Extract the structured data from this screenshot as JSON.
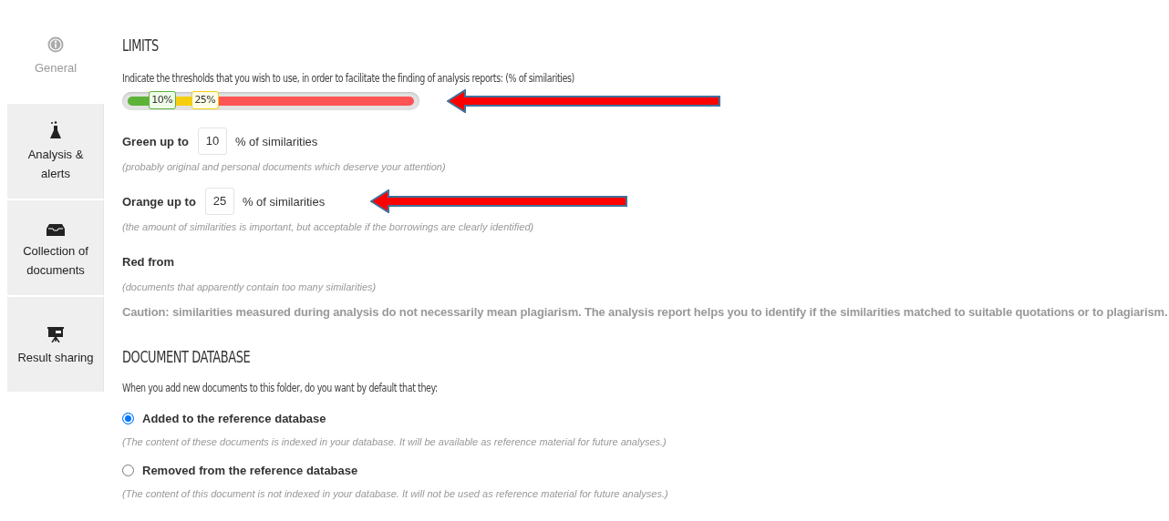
{
  "sidebar": {
    "items": [
      {
        "label": "General",
        "selected": true
      },
      {
        "label": "Analysis & alerts",
        "selected": false
      },
      {
        "label": "Collection of documents",
        "selected": false
      },
      {
        "label": "Result sharing",
        "selected": false
      }
    ]
  },
  "limits": {
    "title": "LIMITS",
    "description": "Indicate the thresholds that you wish to use, in order to facilitate the finding of analysis reports: (% of similarities)",
    "slider": {
      "thumbs": [
        {
          "label": "10%",
          "level": 0.12,
          "color": "#5cb338"
        },
        {
          "label": "25%",
          "level": 0.27,
          "color": "#f5cf0f"
        }
      ]
    },
    "thresholds": [
      {
        "label": "Green up to",
        "value": "10",
        "unit": "% of similarities",
        "hint": "(probably original and personal documents which deserve your attention)"
      },
      {
        "label": "Orange up to",
        "value": "25",
        "unit": "% of similarities",
        "hint": "(the amount of similarities is important, but acceptable if the borrowings are clearly identified)"
      },
      {
        "label": "Red from",
        "hint": "(documents that apparently contain too many similarities)"
      }
    ],
    "caution": "Caution: similarities measured during analysis do not necessarily mean plagiarism. The analysis report helps you to identify if the similarities matched to suitable quotations or to plagiarism."
  },
  "document_database": {
    "title": "DOCUMENT DATABASE",
    "question": "When you add new documents to this folder, do you want by default that they:",
    "options": [
      {
        "label": "Added to the reference database",
        "hint": "(The content of these documents is indexed in your database. It will be available as reference material for future analyses.)",
        "selected": true
      },
      {
        "label": "Removed from the reference database",
        "hint": "(The content of this document is not indexed in your database. It will not be used as reference material for future analyses.)",
        "selected": false
      }
    ]
  }
}
